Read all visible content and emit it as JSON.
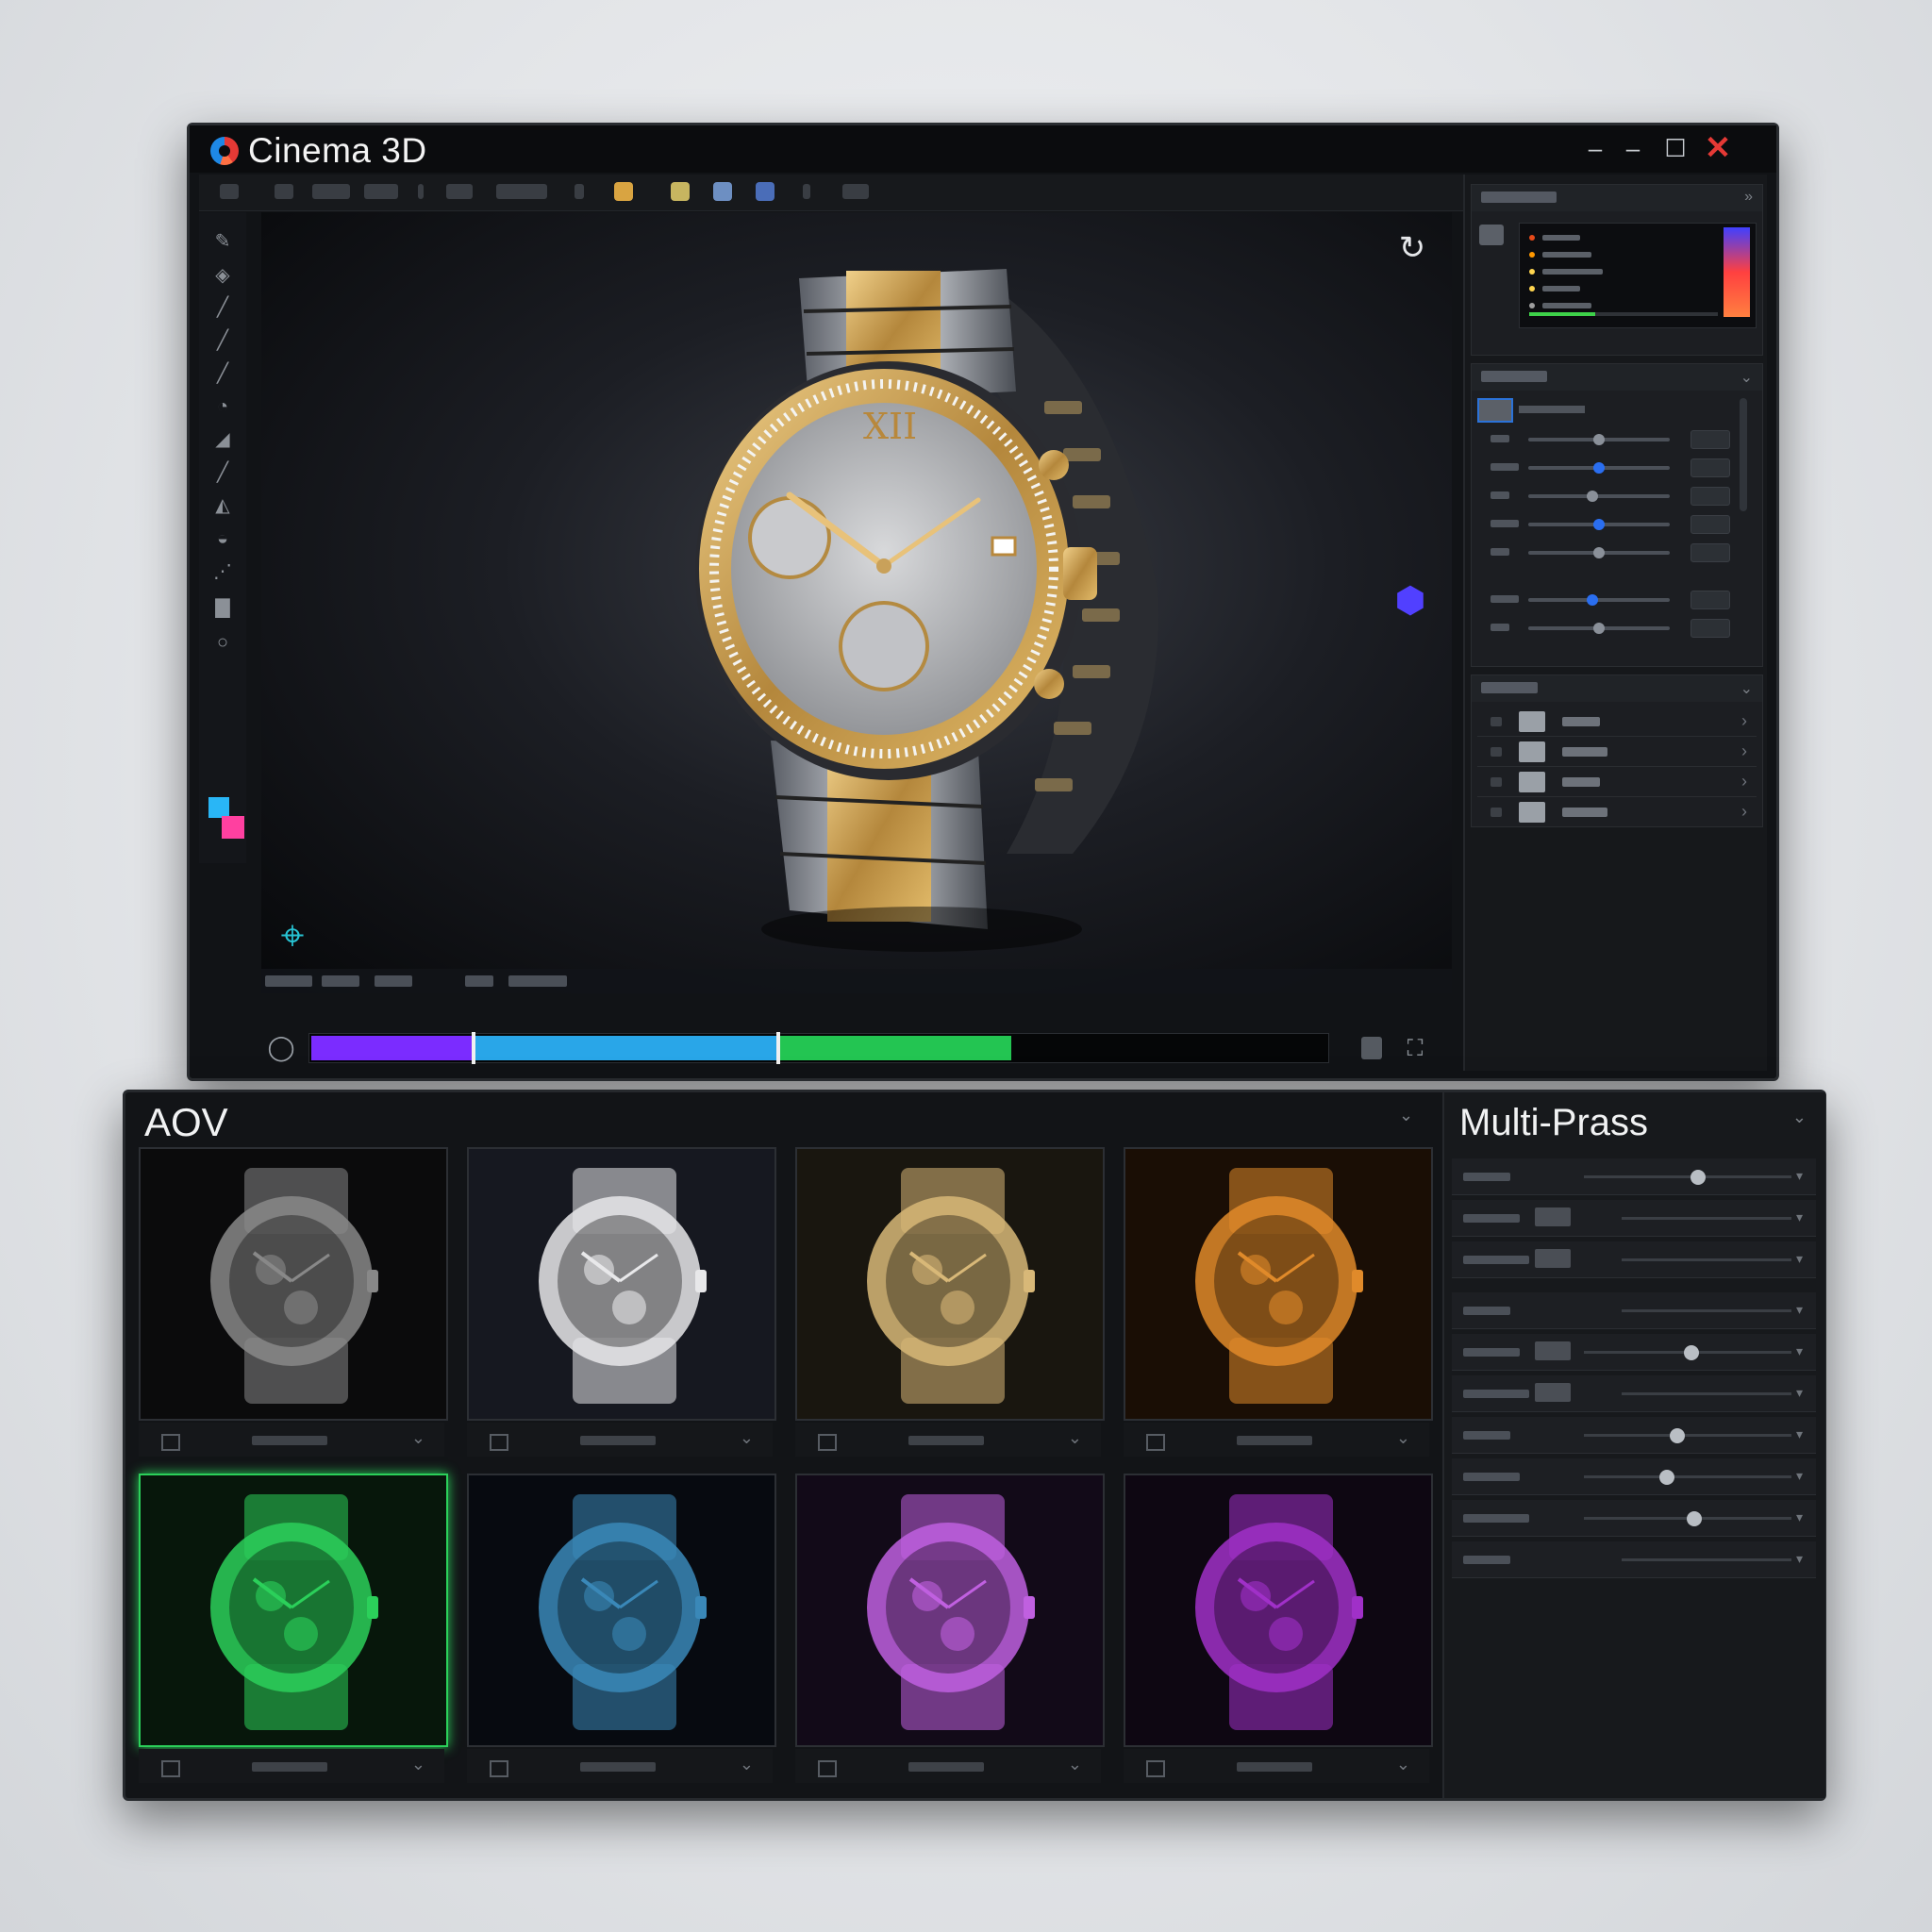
{
  "app": {
    "title": "Cinema 3D",
    "logo_icon": "cinema-logo-icon"
  },
  "window_controls": {
    "minimize": "–",
    "restore": "–",
    "maximize": "☐",
    "close": "✕"
  },
  "viewport": {
    "nav_icon": "↻",
    "gizmo_icon": "⬢",
    "target_icon": "⌖",
    "colors": {
      "gold": "#c9a15a",
      "steel": "#9aa0a8",
      "dial": "#c8c9cb"
    }
  },
  "timeline": {
    "play_icon": "◯",
    "fullscreen_icon": "⛶",
    "segments": [
      {
        "color": "#7b2cff",
        "start": 0.0,
        "end": 0.16
      },
      {
        "color": "#29a6e8",
        "start": 0.16,
        "end": 0.46
      },
      {
        "color": "#23c552",
        "start": 0.46,
        "end": 0.69
      }
    ],
    "markers": [
      0.16,
      0.46
    ]
  },
  "right_panel": {
    "graph_dot_colors": [
      "#e64a19",
      "#ff9800",
      "#ffd54f",
      "#ffd54f",
      "#9e9e9e"
    ],
    "slider_positions": [
      0.5,
      0.5,
      0.45,
      0.5,
      0.5,
      0.45,
      0.5
    ],
    "layer_count": 4
  },
  "aov": {
    "title": "AOV",
    "thumbnails": [
      {
        "tint": "#888888",
        "bg": "#0b0b0c",
        "selected": false
      },
      {
        "tint": "#e8e8ea",
        "bg": "#161820",
        "selected": false
      },
      {
        "tint": "#d8b878",
        "bg": "#19160f",
        "selected": false
      },
      {
        "tint": "#e08a2a",
        "bg": "#1a0e05",
        "selected": false
      },
      {
        "tint": "#2bd05a",
        "bg": "#07170b",
        "selected": true
      },
      {
        "tint": "#3a88b8",
        "bg": "#070a10",
        "selected": false
      },
      {
        "tint": "#c060e0",
        "bg": "#120a18",
        "selected": false
      },
      {
        "tint": "#a030c8",
        "bg": "#0e0712",
        "selected": false
      }
    ]
  },
  "multipass": {
    "title": "Multi-Prass",
    "rows": [
      {
        "knob": 0.55
      },
      {
        "knob": null
      },
      {
        "knob": null
      },
      {
        "knob": null
      },
      {
        "knob": 0.52
      },
      {
        "knob": null
      },
      {
        "knob": 0.45
      },
      {
        "knob": 0.4
      },
      {
        "knob": 0.53
      },
      {
        "knob": null
      }
    ]
  }
}
